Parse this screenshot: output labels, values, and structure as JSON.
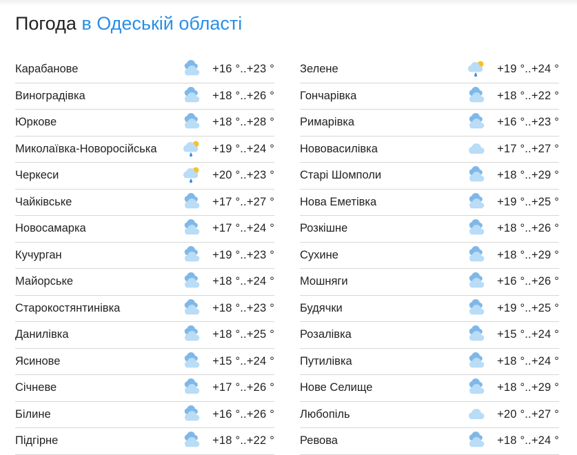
{
  "title": {
    "main": "Погода",
    "accent": "в Одеській області"
  },
  "left": [
    {
      "city": "Карабанове",
      "temp": "+16 °..+23 °",
      "icon": "cloudy-icon"
    },
    {
      "city": "Виноградівка",
      "temp": "+18 °..+26 °",
      "icon": "cloudy-icon"
    },
    {
      "city": "Юркове",
      "temp": "+18 °..+28 °",
      "icon": "cloudy-icon"
    },
    {
      "city": "Миколаївка-Новоросійська",
      "temp": "+19 °..+24 °",
      "icon": "partly-cloudy-rain-icon"
    },
    {
      "city": "Черкеси",
      "temp": "+20 °..+23 °",
      "icon": "partly-cloudy-rain-icon"
    },
    {
      "city": "Чайківське",
      "temp": "+17 °..+27 °",
      "icon": "cloudy-icon"
    },
    {
      "city": "Новосамарка",
      "temp": "+17 °..+24 °",
      "icon": "cloudy-icon"
    },
    {
      "city": "Кучурган",
      "temp": "+19 °..+23 °",
      "icon": "cloudy-icon"
    },
    {
      "city": "Майорське",
      "temp": "+18 °..+24 °",
      "icon": "cloudy-icon"
    },
    {
      "city": "Старокостянтинівка",
      "temp": "+18 °..+23 °",
      "icon": "cloudy-icon"
    },
    {
      "city": "Данилівка",
      "temp": "+18 °..+25 °",
      "icon": "cloudy-icon"
    },
    {
      "city": "Ясинове",
      "temp": "+15 °..+24 °",
      "icon": "cloudy-icon"
    },
    {
      "city": "Січневе",
      "temp": "+17 °..+26 °",
      "icon": "cloudy-icon"
    },
    {
      "city": "Білине",
      "temp": "+16 °..+26 °",
      "icon": "cloudy-icon"
    },
    {
      "city": "Підгірне",
      "temp": "+18 °..+22 °",
      "icon": "cloudy-icon"
    }
  ],
  "right": [
    {
      "city": "Зелене",
      "temp": "+19 °..+24 °",
      "icon": "partly-cloudy-rain-icon"
    },
    {
      "city": "Гончарівка",
      "temp": "+18 °..+22 °",
      "icon": "cloudy-icon"
    },
    {
      "city": "Римарівка",
      "temp": "+16 °..+23 °",
      "icon": "cloudy-icon"
    },
    {
      "city": "Нововасилівка",
      "temp": "+17 °..+27 °",
      "icon": "overcast-icon"
    },
    {
      "city": "Старі Шомполи",
      "temp": "+18 °..+29 °",
      "icon": "cloudy-icon"
    },
    {
      "city": "Нова Еметівка",
      "temp": "+19 °..+25 °",
      "icon": "cloudy-icon"
    },
    {
      "city": "Розкішне",
      "temp": "+18 °..+26 °",
      "icon": "cloudy-icon"
    },
    {
      "city": "Сухине",
      "temp": "+18 °..+29 °",
      "icon": "cloudy-icon"
    },
    {
      "city": "Мошняги",
      "temp": "+16 °..+26 °",
      "icon": "cloudy-icon"
    },
    {
      "city": "Будячки",
      "temp": "+19 °..+25 °",
      "icon": "cloudy-icon"
    },
    {
      "city": "Розалівка",
      "temp": "+15 °..+24 °",
      "icon": "cloudy-icon"
    },
    {
      "city": "Путилівка",
      "temp": "+18 °..+24 °",
      "icon": "cloudy-icon"
    },
    {
      "city": "Нове Селище",
      "temp": "+18 °..+29 °",
      "icon": "cloudy-icon"
    },
    {
      "city": "Любопіль",
      "temp": "+20 °..+27 °",
      "icon": "overcast-icon"
    },
    {
      "city": "Ревова",
      "temp": "+18 °..+24 °",
      "icon": "cloudy-icon"
    }
  ],
  "colors": {
    "accent": "#2a8ee6",
    "cloud_back": "#7fb8e8",
    "cloud_front": "#b9dcf7",
    "sun": "#f7c325",
    "rain": "#3a8fe0"
  }
}
